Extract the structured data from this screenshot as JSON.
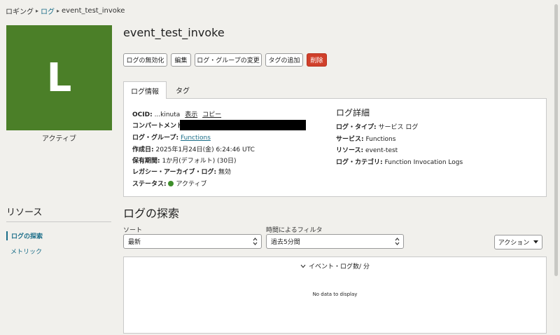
{
  "breadcrumb": {
    "root": "ロギング",
    "logs": "ログ",
    "current": "event_test_invoke"
  },
  "tile": {
    "letter": "L",
    "status": "アクティブ",
    "color": "#4b7f28"
  },
  "title": "event_test_invoke",
  "actions": {
    "disable": "ログの無効化",
    "edit": "編集",
    "change_group": "ログ・グループの変更",
    "add_tag": "タグの追加",
    "delete": "削除"
  },
  "tabs": {
    "info": "ログ情報",
    "tags": "タグ"
  },
  "info": {
    "ocid_label": "OCID:",
    "ocid_value": "...kinuta",
    "ocid_show": "表示",
    "ocid_copy": "コピー",
    "compartment_label": "コンパートメント:",
    "log_group_label": "ログ・グループ:",
    "log_group_value": "Functions",
    "created_label": "作成日:",
    "created_value": "2025年1月24日(金) 6:24:46 UTC",
    "retention_label": "保有期間:",
    "retention_value": "1か月(デフォルト) (30日)",
    "legacy_label": "レガシー・アーカイブ・ログ:",
    "legacy_value": "無効",
    "status_label": "ステータス:",
    "status_value": "アクティブ"
  },
  "details": {
    "heading": "ログ詳細",
    "type_label": "ログ・タイプ:",
    "type_value": "サービス ログ",
    "service_label": "サービス:",
    "service_value": "Functions",
    "resource_label": "リソース:",
    "resource_value": "event-test",
    "category_label": "ログ・カテゴリ:",
    "category_value": "Function Invocation Logs"
  },
  "resources": {
    "heading": "リソース",
    "items": [
      "ログの探索",
      "メトリック"
    ]
  },
  "search": {
    "heading": "ログの探索",
    "sort_label": "ソート",
    "sort_value": "最新",
    "filter_label": "時間によるフィルタ",
    "filter_value": "過去5分間",
    "action_label": "アクション",
    "chart_title": "イベント・ログ数/ 分",
    "no_data": "No data to display"
  },
  "colors": {
    "accent": "#1a6d88",
    "danger": "#d0402b",
    "active": "#3e8e2b"
  }
}
